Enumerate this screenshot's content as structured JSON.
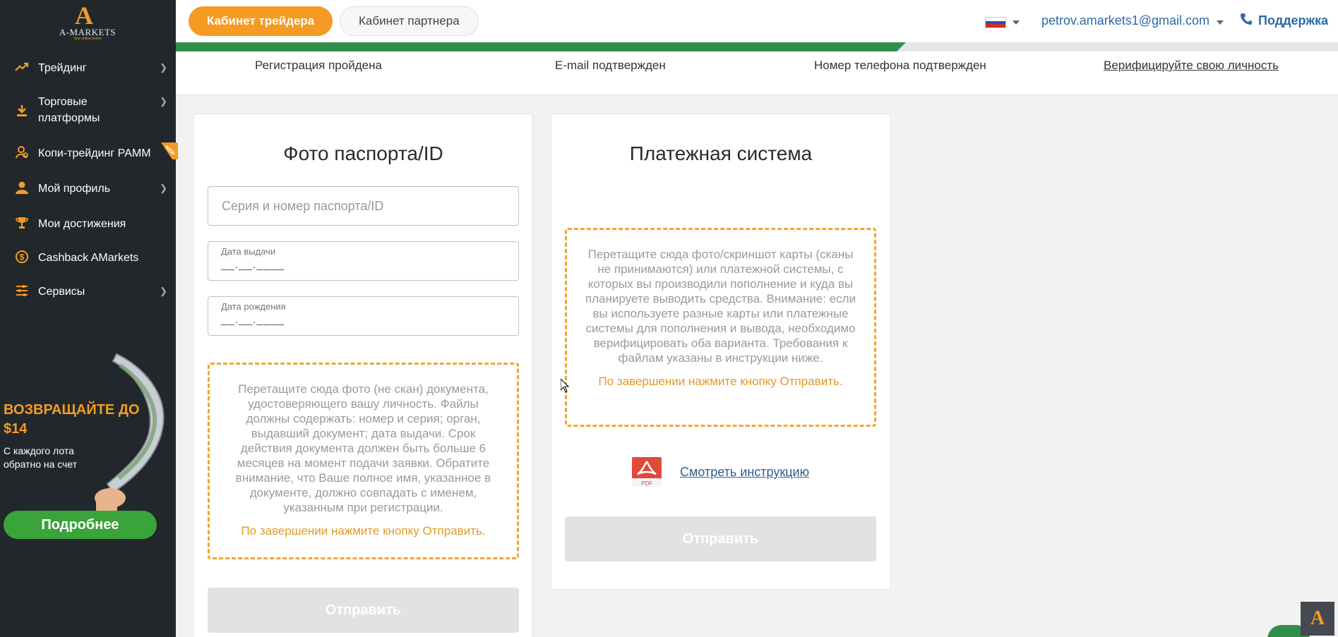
{
  "sidebar": {
    "logo": {
      "letter": "A",
      "text": "A-MARKETS",
      "tagline": "Your online broker"
    },
    "items": [
      {
        "label": "Трейдинг",
        "icon": "trending-icon",
        "has_chevron": true
      },
      {
        "label": "Торговые платформы",
        "icon": "download-icon",
        "has_chevron": true
      },
      {
        "label": "Копи-трейдинг РАММ",
        "icon": "copy-trading-icon",
        "has_chevron": false,
        "badge": "NEW"
      },
      {
        "label": "Мой профиль",
        "icon": "user-icon",
        "has_chevron": true
      },
      {
        "label": "Мои достижения",
        "icon": "trophy-icon",
        "has_chevron": false
      },
      {
        "label": "Cashback AMarkets",
        "icon": "cashback-icon",
        "has_chevron": false
      },
      {
        "label": "Сервисы",
        "icon": "sliders-icon",
        "has_chevron": true
      }
    ],
    "promo": {
      "title": "ВОЗВРАЩАЙТЕ ДО $14",
      "subtitle": "С каждого лота обратно на счет",
      "button": "Подробнее"
    }
  },
  "header": {
    "trader_button": "Кабинет трейдера",
    "partner_button": "Кабинет партнера",
    "language_flag": "ru",
    "email": "petrov.amarkets1@gmail.com",
    "support": "Поддержка"
  },
  "progress": {
    "fraction": 0.62
  },
  "steps": [
    {
      "label": "Регистрация пройдена",
      "link": false
    },
    {
      "label": "E-mail подтвержден",
      "link": false
    },
    {
      "label": "Номер телефона подтвержден",
      "link": false
    },
    {
      "label": "Верифицируйте свою личность",
      "link": true
    }
  ],
  "passport_card": {
    "title": "Фото паспорта/ID",
    "series_placeholder": "Серия и номер паспорта/ID",
    "issue_date_label": "Дата выдачи",
    "issue_date_mask": "__.__.____",
    "birth_date_label": "Дата рождения",
    "birth_date_mask": "__.__.____",
    "dropzone_text": "Перетащите сюда фото (не скан) документа, удостоверяющего вашу личность. Файлы должны содержать: номер и серия; орган, выдавший документ; дата выдачи. Срок действия документа должен быть больше 6 месяцев на момент подачи заявки. Обратите внимание, что Ваше полное имя, указанное в документе, должно совпадать с именем, указанным при регистрации.",
    "dropzone_done": "По завершении нажмите кнопку Отправить.",
    "submit": "Отправить"
  },
  "payment_card": {
    "title": "Платежная система",
    "dropzone_text": "Перетащите сюда фото/скриншот карты (сканы не принимаются) или платежной системы, с которых вы производили пополнение и куда вы планируете выводить средства. Внимание: если вы используете разные карты или платежные системы для пополнения и вывода, необходимо верифицировать оба варианта. Требования к файлам указаны в инструкции ниже.",
    "dropzone_done": "По завершении нажмите кнопку Отправить.",
    "instruction_link": "Смотреть инструкцию",
    "pdf_label": "PDF",
    "submit": "Отправить"
  },
  "colors": {
    "accent": "#f59a23",
    "sidebar": "#22272b",
    "success": "#2f8f4a",
    "link": "#2f6aa8"
  }
}
